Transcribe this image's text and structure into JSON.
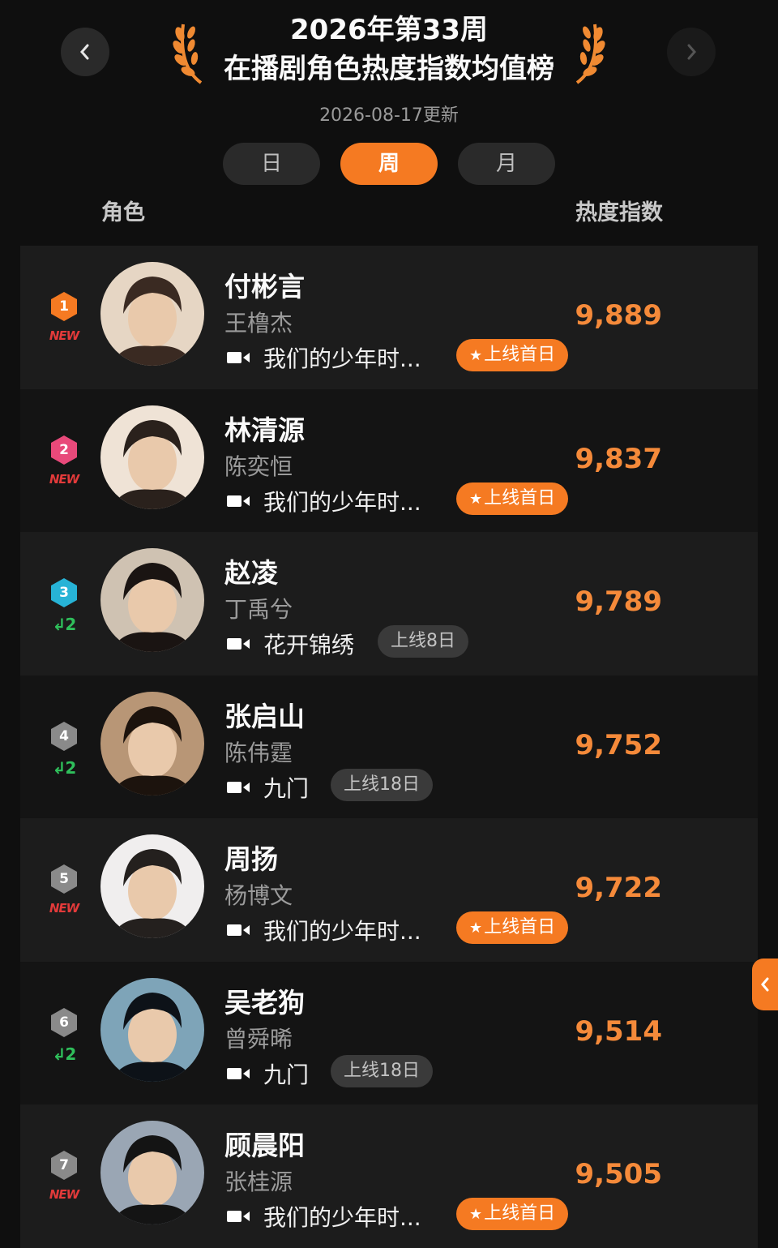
{
  "header": {
    "title_line1": "2026年第33周",
    "title_line2": "在播剧角色热度指数均值榜",
    "update_date": "2026-08-17更新"
  },
  "tabs": [
    {
      "label": "日",
      "active": false
    },
    {
      "label": "周",
      "active": true
    },
    {
      "label": "月",
      "active": false
    }
  ],
  "columns": {
    "left": "角色",
    "right": "热度指数"
  },
  "colors": {
    "accent": "#f57a22",
    "heat": "#f58a3a",
    "new": "#e23a3a",
    "up": "#2fbf5b"
  },
  "rankings": [
    {
      "rank": "1",
      "change": "NEW",
      "change_type": "new",
      "character": "付彬言",
      "actor": "王橹杰",
      "show": "我们的少年时...",
      "badge": "上线首日",
      "badge_type": "premiere",
      "heat": "9,889",
      "badge_color": "#f57a22"
    },
    {
      "rank": "2",
      "change": "NEW",
      "change_type": "new",
      "character": "林清源",
      "actor": "陈奕恒",
      "show": "我们的少年时...",
      "badge": "上线首日",
      "badge_type": "premiere",
      "heat": "9,837",
      "badge_color": "#e8497a"
    },
    {
      "rank": "3",
      "change": "↲2",
      "change_type": "up",
      "character": "赵凌",
      "actor": "丁禹兮",
      "show": "花开锦绣",
      "badge": "上线8日",
      "badge_type": "days",
      "heat": "9,789",
      "badge_color": "#27b3d6"
    },
    {
      "rank": "4",
      "change": "↲2",
      "change_type": "up",
      "character": "张启山",
      "actor": "陈伟霆",
      "show": "九门",
      "badge": "上线18日",
      "badge_type": "days",
      "heat": "9,752",
      "badge_color": "#8a8a8a"
    },
    {
      "rank": "5",
      "change": "NEW",
      "change_type": "new",
      "character": "周扬",
      "actor": "杨博文",
      "show": "我们的少年时...",
      "badge": "上线首日",
      "badge_type": "premiere",
      "heat": "9,722",
      "badge_color": "#8a8a8a"
    },
    {
      "rank": "6",
      "change": "↲2",
      "change_type": "up",
      "character": "吴老狗",
      "actor": "曾舜晞",
      "show": "九门",
      "badge": "上线18日",
      "badge_type": "days",
      "heat": "9,514",
      "badge_color": "#8a8a8a"
    },
    {
      "rank": "7",
      "change": "NEW",
      "change_type": "new",
      "character": "顾晨阳",
      "actor": "张桂源",
      "show": "我们的少年时...",
      "badge": "上线首日",
      "badge_type": "premiere",
      "heat": "9,505",
      "badge_color": "#8a8a8a"
    }
  ]
}
